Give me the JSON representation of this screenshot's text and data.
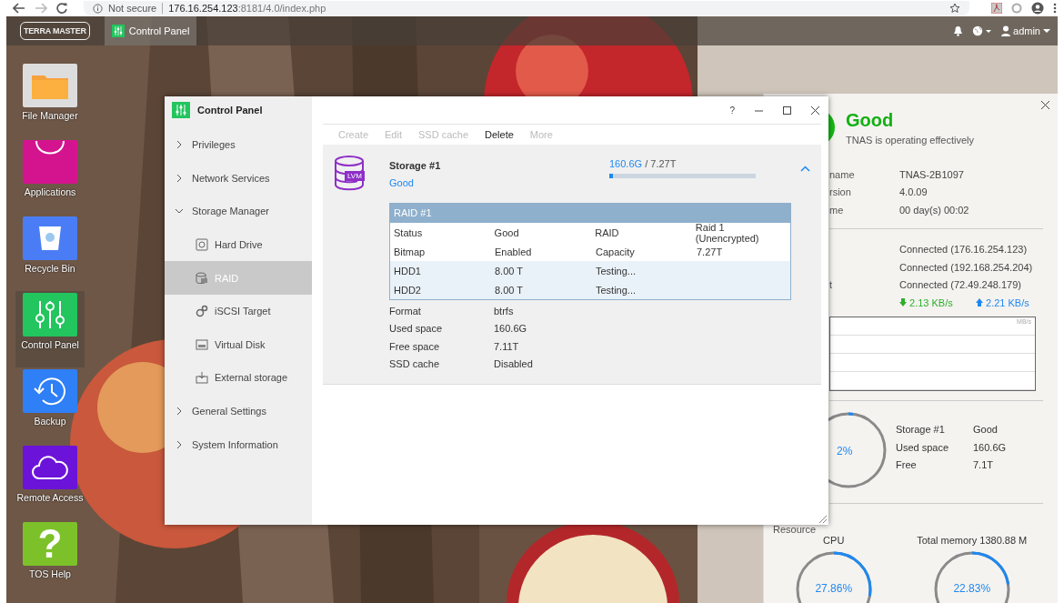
{
  "browser": {
    "security": "Not secure",
    "url_host": "176.16.254.123",
    "url_path": ":8181/4.0/index.php"
  },
  "taskbar": {
    "logo": "TERRA MASTER",
    "apps": [
      {
        "label": "Control Panel",
        "selected": true
      }
    ],
    "user": "admin"
  },
  "desktop_icons": [
    {
      "label": "File Manager",
      "kind": "folder",
      "selected": false
    },
    {
      "label": "Applications",
      "kind": "bag",
      "selected": false
    },
    {
      "label": "Recycle Bin",
      "kind": "bin",
      "selected": false
    },
    {
      "label": "Control Panel",
      "kind": "sliders",
      "selected": true
    },
    {
      "label": "Backup",
      "kind": "clock",
      "selected": false
    },
    {
      "label": "Remote Access",
      "kind": "cloud",
      "selected": false
    },
    {
      "label": "TOS Help",
      "kind": "help",
      "glyph": "?",
      "selected": false
    }
  ],
  "control_panel": {
    "title": "Control Panel",
    "help": "?",
    "sidebar": [
      {
        "label": "Privileges",
        "expanded": false
      },
      {
        "label": "Network Services",
        "expanded": false
      },
      {
        "label": "Storage Manager",
        "expanded": true,
        "children": [
          {
            "label": "Hard Drive",
            "kind": "drive",
            "selected": false
          },
          {
            "label": "RAID",
            "kind": "raid",
            "selected": true
          },
          {
            "label": "iSCSI Target",
            "kind": "network",
            "selected": false
          },
          {
            "label": "Virtual Disk",
            "kind": "disk",
            "selected": false
          },
          {
            "label": "External storage",
            "kind": "external",
            "selected": false
          }
        ]
      },
      {
        "label": "General Settings",
        "expanded": false
      },
      {
        "label": "System Information",
        "expanded": false
      }
    ],
    "toolbar": [
      {
        "label": "Create",
        "disabled": true
      },
      {
        "label": "Edit",
        "disabled": true
      },
      {
        "label": "SSD cache",
        "disabled": true
      },
      {
        "label": "Delete",
        "disabled": false
      },
      {
        "label": "More",
        "disabled": true
      }
    ],
    "storage": {
      "badge": "LVM",
      "name": "Storage #1",
      "status": "Good",
      "used": "160.6G",
      "total": " / 7.27T",
      "level": 0.022,
      "expanded": true,
      "raid": {
        "title": "RAID #1",
        "rows": [
          {
            "kind": "info",
            "cells": [
              "Status",
              "Good",
              "RAID",
              "Raid 1 (Unencrypted)"
            ]
          },
          {
            "kind": "info",
            "cells": [
              "Bitmap",
              "Enabled",
              "Capacity",
              "7.27T"
            ]
          },
          {
            "kind": "disk",
            "cells": [
              "HDD1",
              "8.00 T",
              "Testing..."
            ]
          },
          {
            "kind": "disk",
            "cells": [
              "HDD2",
              "8.00 T",
              "Testing..."
            ]
          }
        ]
      },
      "details": [
        {
          "label": "Format",
          "value": "btrfs"
        },
        {
          "label": "Used space",
          "value": "160.6G"
        },
        {
          "label": "Free space",
          "value": "7.11T"
        },
        {
          "label": "SSD cache",
          "value": "Disabled"
        }
      ]
    }
  },
  "status_panel": {
    "status": "Good",
    "message": "TNAS is operating effectively",
    "system": [
      {
        "label": "name",
        "value": "TNAS-2B1097"
      },
      {
        "label": "rsion",
        "value": "4.0.09"
      },
      {
        "label": "me",
        "value": "00 day(s) 00:02"
      }
    ],
    "network": [
      {
        "value": "Connected (176.16.254.123)"
      },
      {
        "value": "Connected (192.168.254.204)"
      },
      {
        "label": "t",
        "value": "Connected (72.49.248.179)"
      }
    ],
    "download": "2.13 KB/s",
    "upload": "2.21 KB/s",
    "chart_unit": "MB/s",
    "storage": {
      "percent": "2%",
      "level": 0.02,
      "rows": [
        {
          "label": "Storage #1",
          "value": "Good"
        },
        {
          "label": "Used space",
          "value": "160.6G"
        },
        {
          "label": "Free",
          "value": "7.1T"
        }
      ]
    },
    "resource": {
      "title": "Resource",
      "meters": [
        {
          "label": "CPU",
          "value": "27.86%",
          "level": 0.2786
        },
        {
          "label": "Total memory 1380.88 M",
          "value": "22.83%",
          "level": 0.2283
        }
      ]
    }
  }
}
